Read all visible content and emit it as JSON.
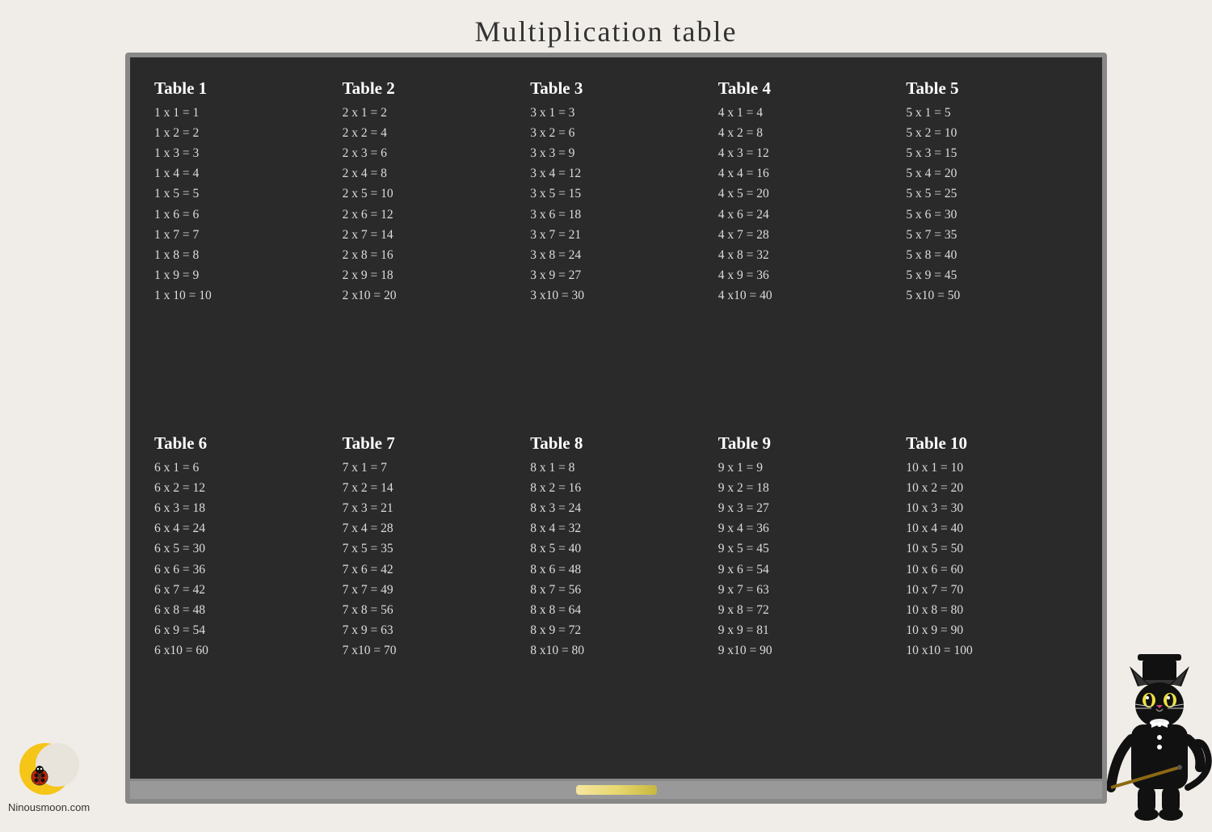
{
  "page": {
    "title": "Multiplication table",
    "logo_text": "Ninousmoon.com"
  },
  "tables": [
    {
      "title": "Table  1",
      "rows": [
        "1 x  1  = 1",
        "1 x  2  = 2",
        "1 x  3  = 3",
        "1 x  4  = 4",
        "1 x  5  = 5",
        "1 x  6  = 6",
        "1 x  7  = 7",
        "1 x  8  = 8",
        "1 x  9  = 9",
        "1 x 10 = 10"
      ]
    },
    {
      "title": "Table  2",
      "rows": [
        "2 x  1 = 2",
        "2 x  2 = 4",
        "2 x  3 = 6",
        "2 x  4 = 8",
        "2 x  5 = 10",
        "2 x  6 = 12",
        "2 x  7 = 14",
        "2 x  8 = 16",
        "2 x  9 = 18",
        "2 x10 = 20"
      ]
    },
    {
      "title": "Table  3",
      "rows": [
        "3 x  1 = 3",
        "3 x  2 = 6",
        "3 x  3 = 9",
        "3 x  4 = 12",
        "3 x  5 = 15",
        "3 x  6 = 18",
        "3 x  7 = 21",
        "3 x  8 = 24",
        "3 x  9 = 27",
        "3 x10 = 30"
      ]
    },
    {
      "title": "Table  4",
      "rows": [
        "4 x  1 = 4",
        "4 x  2 = 8",
        "4 x  3 = 12",
        "4 x  4 = 16",
        "4 x  5 = 20",
        "4 x  6 = 24",
        "4 x  7 = 28",
        "4 x  8 = 32",
        "4 x  9 = 36",
        "4 x10 = 40"
      ]
    },
    {
      "title": "Table  5",
      "rows": [
        "5 x  1 =  5",
        "5 x  2 = 10",
        "5 x  3 = 15",
        "5 x  4 = 20",
        "5 x  5 = 25",
        "5 x  6 = 30",
        "5 x  7 = 35",
        "5 x  8 = 40",
        "5 x  9 = 45",
        "5 x10 = 50"
      ]
    },
    {
      "title": "Table  6",
      "rows": [
        "6 x  1 =  6",
        "6 x  2 = 12",
        "6 x  3 = 18",
        "6 x  4 = 24",
        "6 x  5 = 30",
        "6 x  6 = 36",
        "6 x  7 = 42",
        "6 x  8 = 48",
        "6 x  9 = 54",
        "6 x10 = 60"
      ]
    },
    {
      "title": "Table  7",
      "rows": [
        "7 x  1 =  7",
        "7 x  2 = 14",
        "7 x  3 = 21",
        "7 x  4 = 28",
        "7 x  5 = 35",
        "7 x  6 = 42",
        "7 x  7 = 49",
        "7 x  8 = 56",
        "7 x  9 = 63",
        "7 x10 = 70"
      ]
    },
    {
      "title": "Table  8",
      "rows": [
        "8 x  1 =  8",
        "8 x  2 = 16",
        "8 x  3 = 24",
        "8 x  4 = 32",
        "8 x  5 = 40",
        "8 x  6 = 48",
        "8 x  7 = 56",
        "8 x  8 = 64",
        "8 x  9 = 72",
        "8 x10 = 80"
      ]
    },
    {
      "title": "Table  9",
      "rows": [
        "9 x  1 =  9",
        "9 x  2 = 18",
        "9 x  3 = 27",
        "9 x  4 = 36",
        "9 x  5 = 45",
        "9 x  6 = 54",
        "9 x  7 = 63",
        "9 x  8 = 72",
        "9 x  9 = 81",
        "9 x10 = 90"
      ]
    },
    {
      "title": "Table 10",
      "rows": [
        "10 x  1 =  10",
        "10 x  2 = 20",
        "10 x  3 = 30",
        "10 x  4 = 40",
        "10 x  5 = 50",
        "10 x  6 = 60",
        "10 x  7 = 70",
        "10 x  8 = 80",
        "10 x  9 = 90",
        "10 x10 = 100"
      ]
    }
  ]
}
